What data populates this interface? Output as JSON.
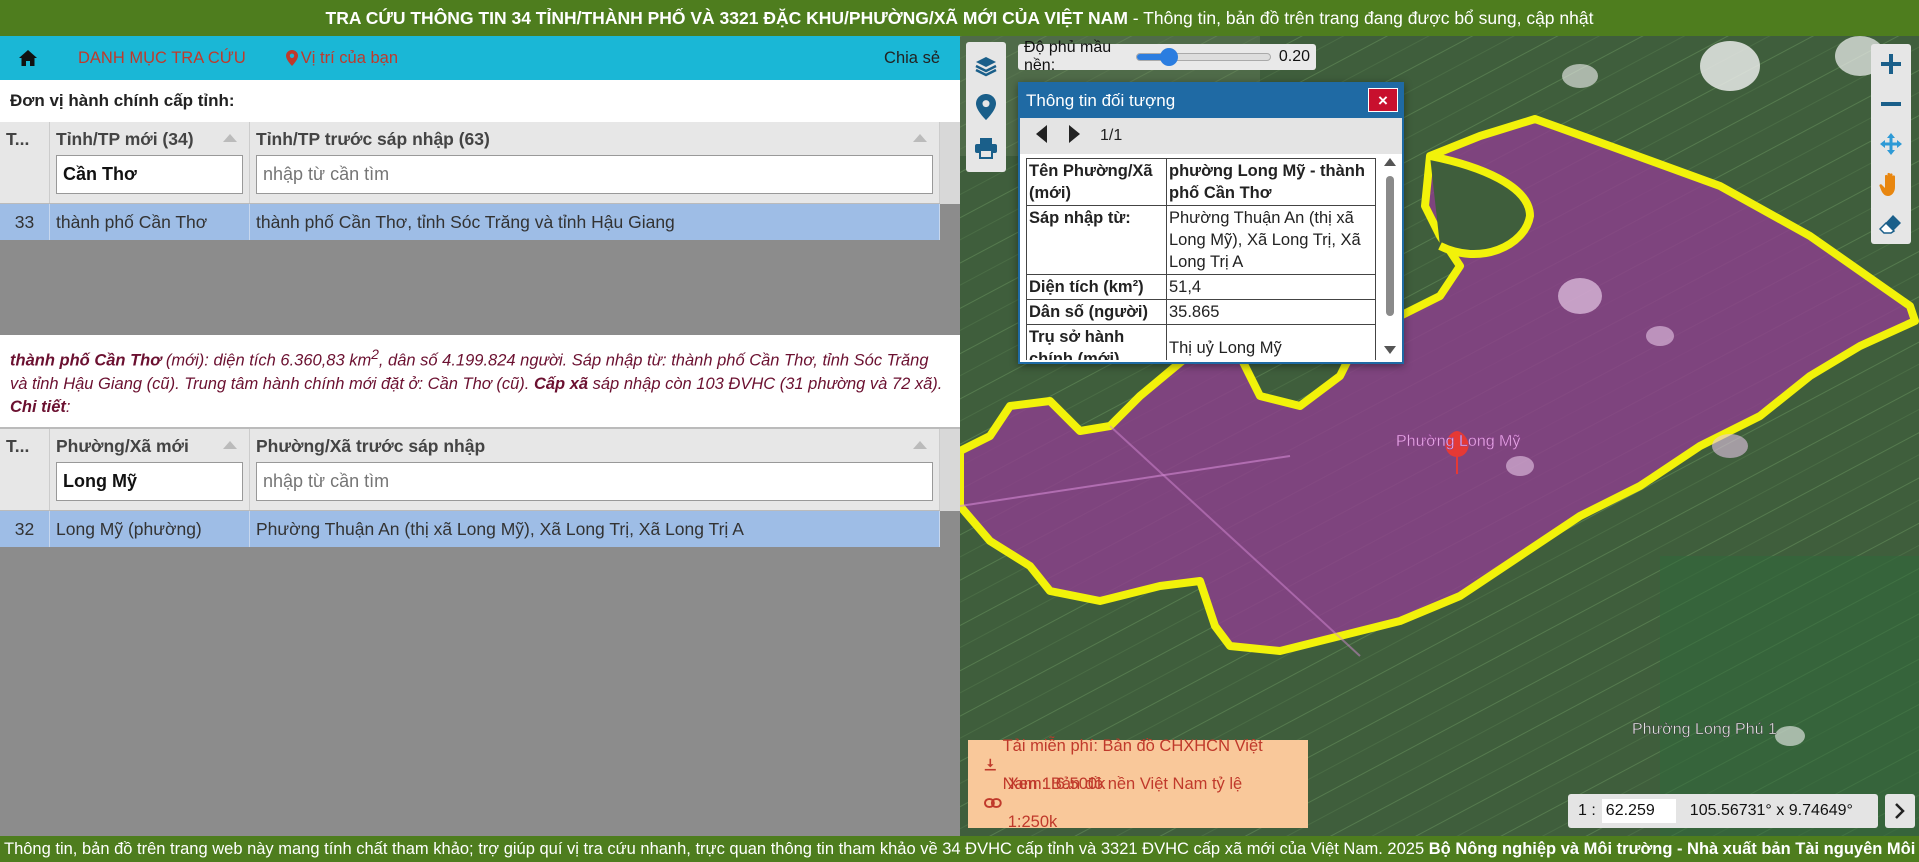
{
  "header": {
    "title_bold": "TRA CỨU THÔNG TIN 34 TỈNH/THÀNH PHỐ VÀ 3321 ĐẶC KHU/PHƯỜNG/XÃ MỚI CỦA VIỆT NAM",
    "title_rest": " - Thông tin, bản đồ trên trang đang được bổ sung, cập nhật"
  },
  "nav": {
    "menu_label": "DANH MỤC TRA CỨU",
    "location_label": "Vị trí của bạn",
    "share_label": "Chia sẻ"
  },
  "province_section": {
    "title": "Đơn vị hành chính cấp tỉnh:",
    "columns": [
      "T...",
      "Tỉnh/TP mới (34)",
      "Tỉnh/TP trước sáp nhập (63)"
    ],
    "filter_value": "Cần Thơ",
    "filter_placeholder": "nhập từ cần tìm",
    "rows": [
      {
        "index": "33",
        "name": "thành phố Cần Thơ",
        "merged": "thành phố Cần Thơ, tỉnh Sóc Trăng và tỉnh Hậu Giang"
      }
    ]
  },
  "description": {
    "name": "thành phố Cần Thơ",
    "text1": " (mới): diện tích 6.360,83 km",
    "sup": "2",
    "text2": ", dân số 4.199.824 người. Sáp nhập từ: thành phố Cần Thơ, tỉnh Sóc Trăng và tỉnh Hậu Giang (cũ). Trung tâm hành chính mới đặt ở: Cần Thơ (cũ). ",
    "cap_xa": "Cấp xã",
    "text3": " sáp nhập còn 103 ĐVHC (31 phường và 72 xã). ",
    "chi_tiet": "Chi tiết",
    "colon": ":"
  },
  "ward_section": {
    "columns": [
      "T...",
      "Phường/Xã mới",
      "Phường/Xã trước sáp nhập"
    ],
    "filter_value": "Long Mỹ",
    "filter_placeholder": "nhập từ cần tìm",
    "rows": [
      {
        "index": "32",
        "name": "Long Mỹ (phường)",
        "merged": "Phường Thuận An (thị xã Long Mỹ), Xã Long Trị, Xã Long Trị A"
      }
    ]
  },
  "map": {
    "opacity_label": "Độ phủ mầu nền:",
    "opacity_value": "0.20",
    "opacity": 0.2,
    "label_main": "Phường Long Mỹ",
    "label_other": "Phường Long Phú 1",
    "scale_prefix": "1 :",
    "scale_value": "62.259",
    "coords": "105.56731° x 9.74649°",
    "promo_download": "Tải miễn phí: Bản đồ CHXHCN Việt Nam 1:6.500k",
    "promo_view": "Xem: Bản đồ nền Việt Nam tỷ lệ 1:250k",
    "colors": {
      "area_fill": "#8e3d8f",
      "boundary": "#f2f20a"
    }
  },
  "popup": {
    "title": "Thông tin đối tượng",
    "close": "×",
    "page": "1/1",
    "rows": [
      {
        "key": "Tên Phường/Xã (mới)",
        "value": "phường Long Mỹ - thành phố Cần Thơ"
      },
      {
        "key": "Sáp nhập từ:",
        "value": "Phường Thuận An (thị xã Long Mỹ), Xã Long Trị, Xã Long Trị A"
      },
      {
        "key": "Diện tích (km²)",
        "value": "51,4"
      },
      {
        "key": "Dân số (người)",
        "value": "35.865"
      },
      {
        "key": "Trụ sở hành chính (mới)",
        "value": "Thị uỷ Long Mỹ"
      }
    ]
  },
  "footer": {
    "text": "Thông tin, bản đồ trên trang web này mang tính chất tham khảo; trợ giúp quí vị tra cứu nhanh, trực quan thông tin tham khảo về 34 ĐVHC cấp tỉnh và 3321 ĐVHC cấp xã mới của Việt Nam. 2025 ",
    "bold": "Bộ Nông nghiệp và Môi trường - Nhà xuất bản Tài nguyên Môi"
  }
}
